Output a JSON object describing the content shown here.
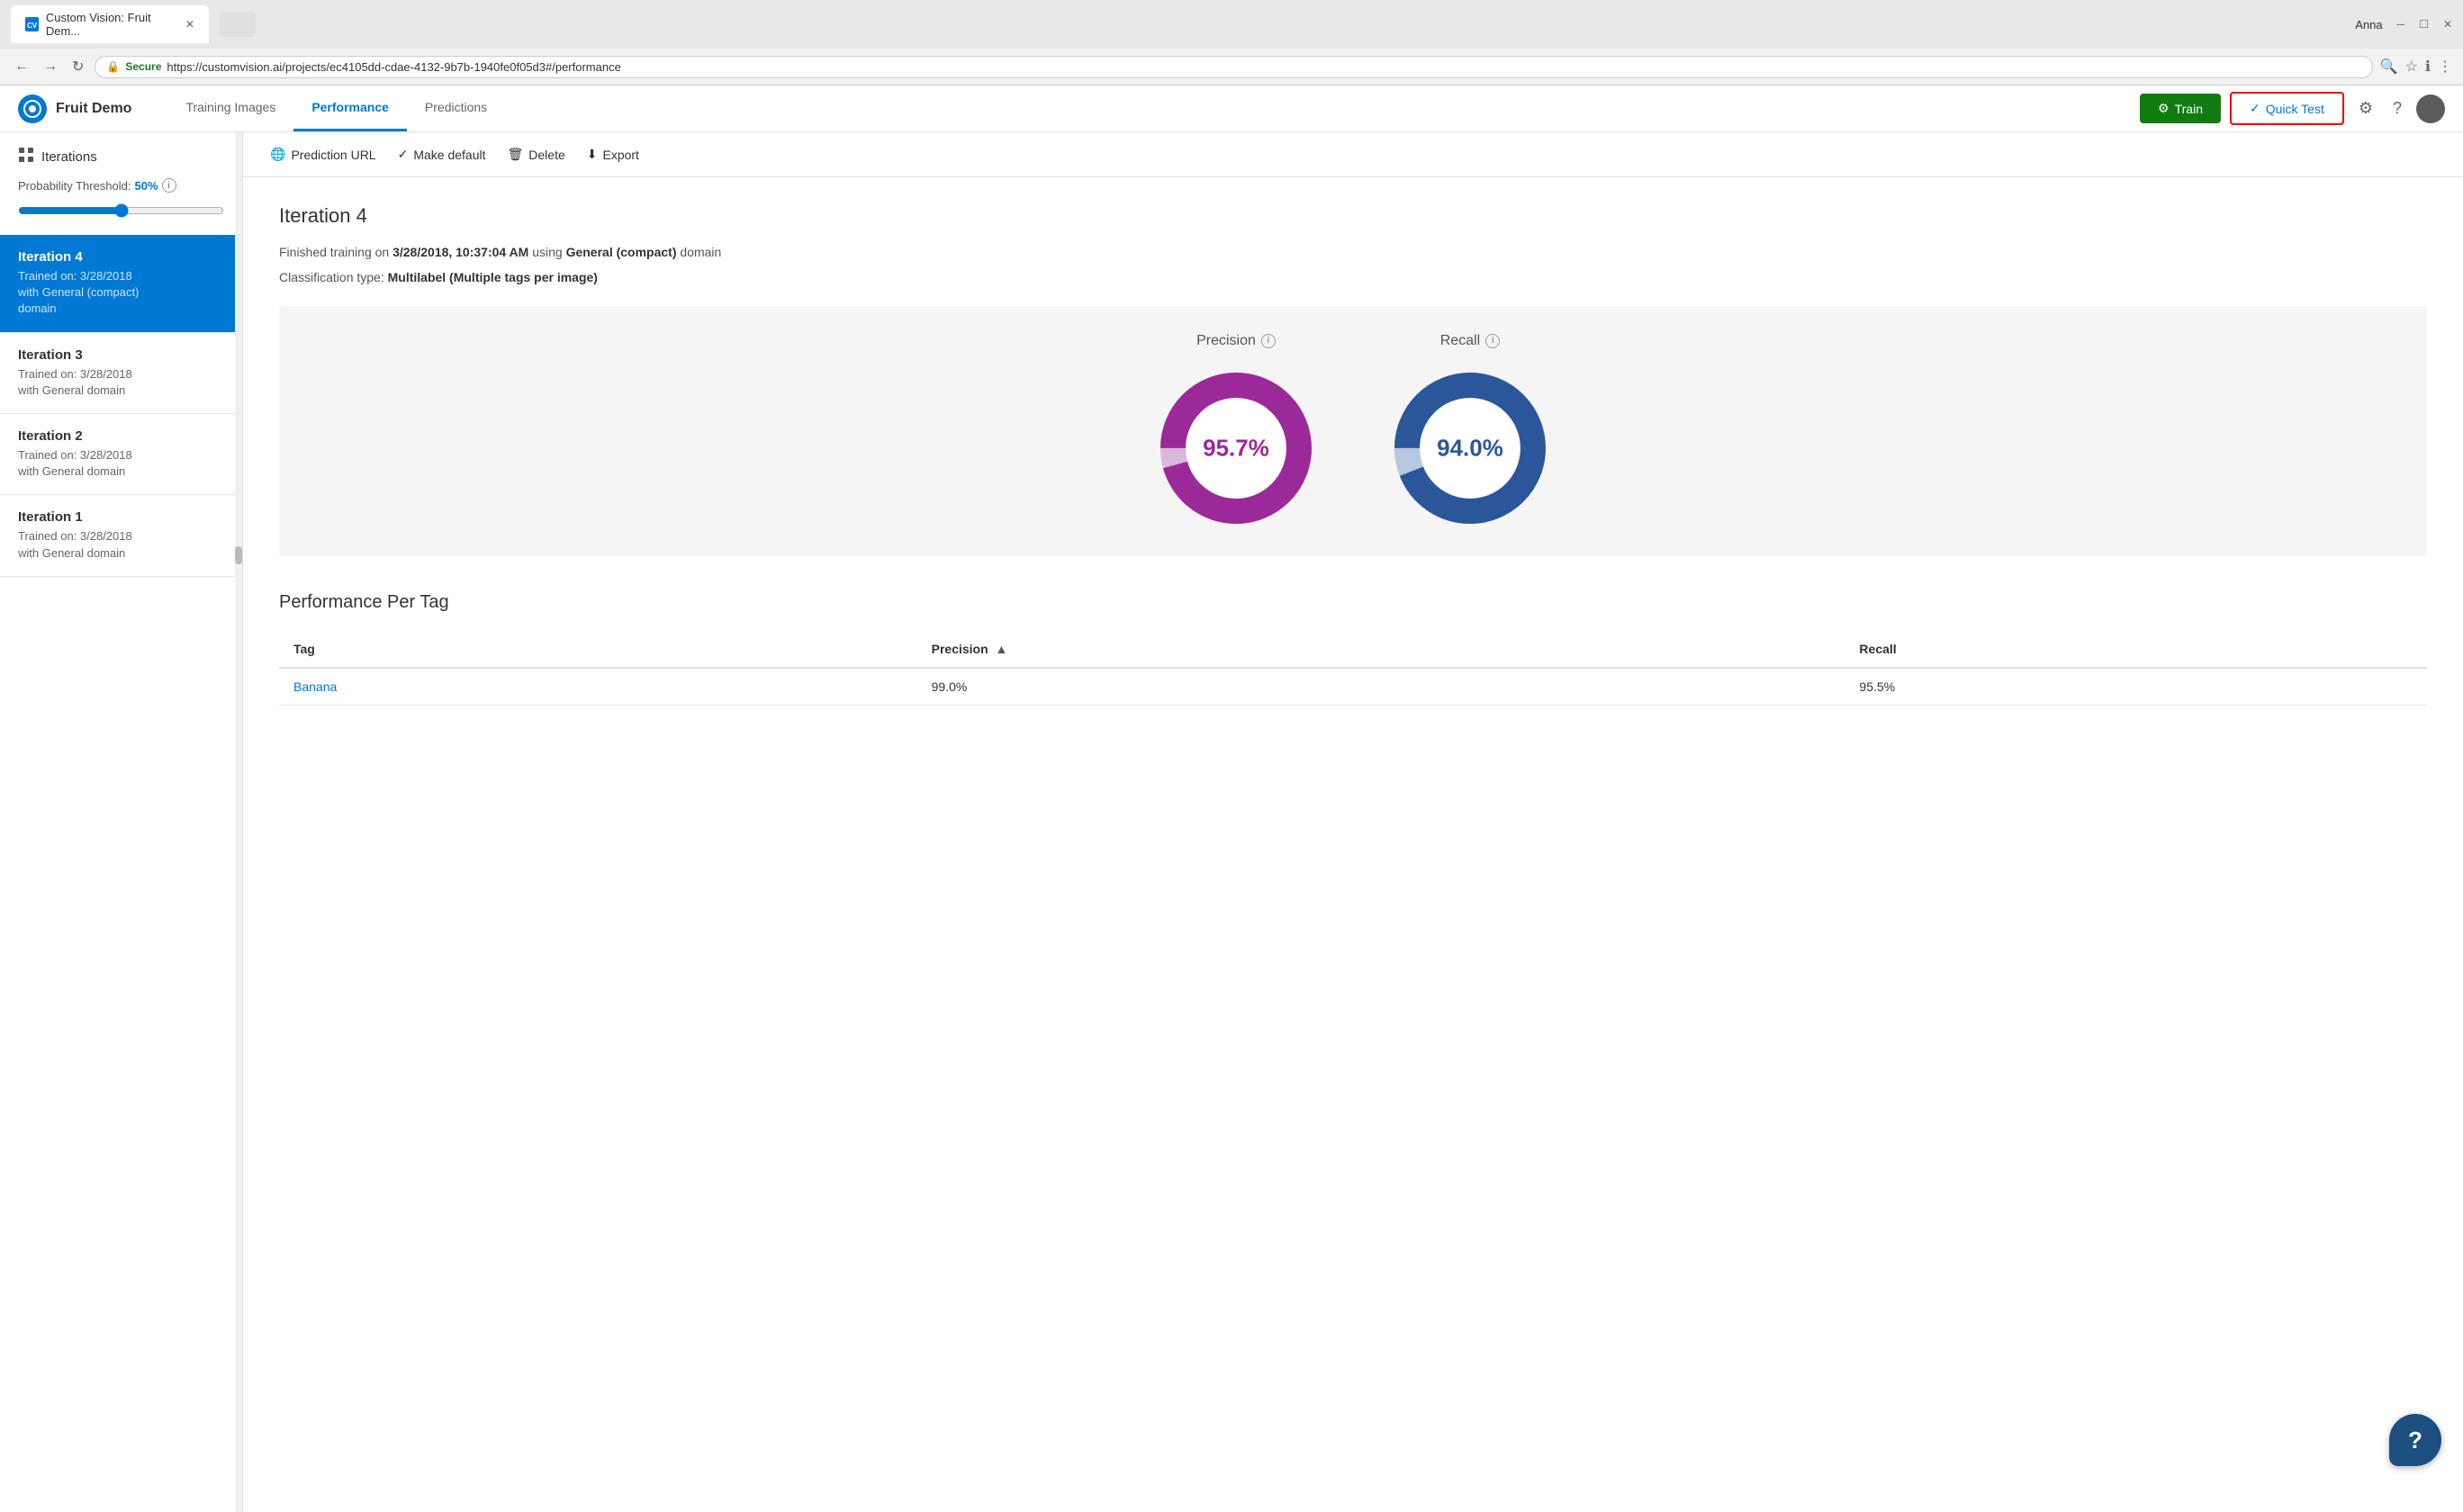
{
  "browser": {
    "tab_title": "Custom Vision: Fruit Dem...",
    "favicon_text": "CV",
    "url": "https://customvision.ai/projects/ec4105dd-cdae-4132-9b7b-1940fe0f05d3#/performance",
    "secure_text": "Secure",
    "user_initials": "Anna"
  },
  "header": {
    "app_name": "Fruit Demo",
    "nav_tabs": [
      {
        "id": "training-images",
        "label": "Training Images",
        "active": false
      },
      {
        "id": "performance",
        "label": "Performance",
        "active": true
      },
      {
        "id": "predictions",
        "label": "Predictions",
        "active": false
      }
    ],
    "btn_train_label": "Train",
    "btn_quick_test_label": "Quick Test"
  },
  "sidebar": {
    "title": "Iterations",
    "probability_threshold_label": "Probability Threshold:",
    "probability_threshold_value": "50%",
    "iterations": [
      {
        "id": "iteration-4",
        "title": "Iteration 4",
        "subtitle": "Trained on: 3/28/2018\nwith General (compact)\ndomain",
        "active": true
      },
      {
        "id": "iteration-3",
        "title": "Iteration 3",
        "subtitle": "Trained on: 3/28/2018\nwith General domain",
        "active": false
      },
      {
        "id": "iteration-2",
        "title": "Iteration 2",
        "subtitle": "Trained on: 3/28/2018\nwith General domain",
        "active": false
      },
      {
        "id": "iteration-1",
        "title": "Iteration 1",
        "subtitle": "Trained on: 3/28/2018\nwith General domain",
        "active": false
      }
    ]
  },
  "toolbar": {
    "prediction_url_label": "Prediction URL",
    "make_default_label": "Make default",
    "delete_label": "Delete",
    "export_label": "Export"
  },
  "main": {
    "page_title": "Iteration 4",
    "training_info_line1_prefix": "Finished training on ",
    "training_info_date": "3/28/2018, 10:37:04 AM",
    "training_info_date_suffix": " using ",
    "training_info_domain": "General (compact)",
    "training_info_domain_suffix": " domain",
    "classification_label": "Classification type:",
    "classification_value": "Multilabel (Multiple tags per image)",
    "precision_label": "Precision",
    "precision_value": "95.7%",
    "precision_color": "#9b2999",
    "recall_label": "Recall",
    "recall_value": "94.0%",
    "recall_color": "#2b579a",
    "precision_pct": 95.7,
    "recall_pct": 94.0,
    "per_tag_section_title": "Performance Per Tag",
    "table_headers": [
      {
        "id": "tag",
        "label": "Tag",
        "sortable": false
      },
      {
        "id": "precision",
        "label": "Precision",
        "sortable": true,
        "sort_dir": "desc"
      },
      {
        "id": "recall",
        "label": "Recall",
        "sortable": false
      }
    ],
    "table_rows": [
      {
        "tag": "Banana",
        "precision": "99.0%",
        "recall": "95.5%"
      }
    ]
  },
  "help": {
    "label": "?"
  }
}
